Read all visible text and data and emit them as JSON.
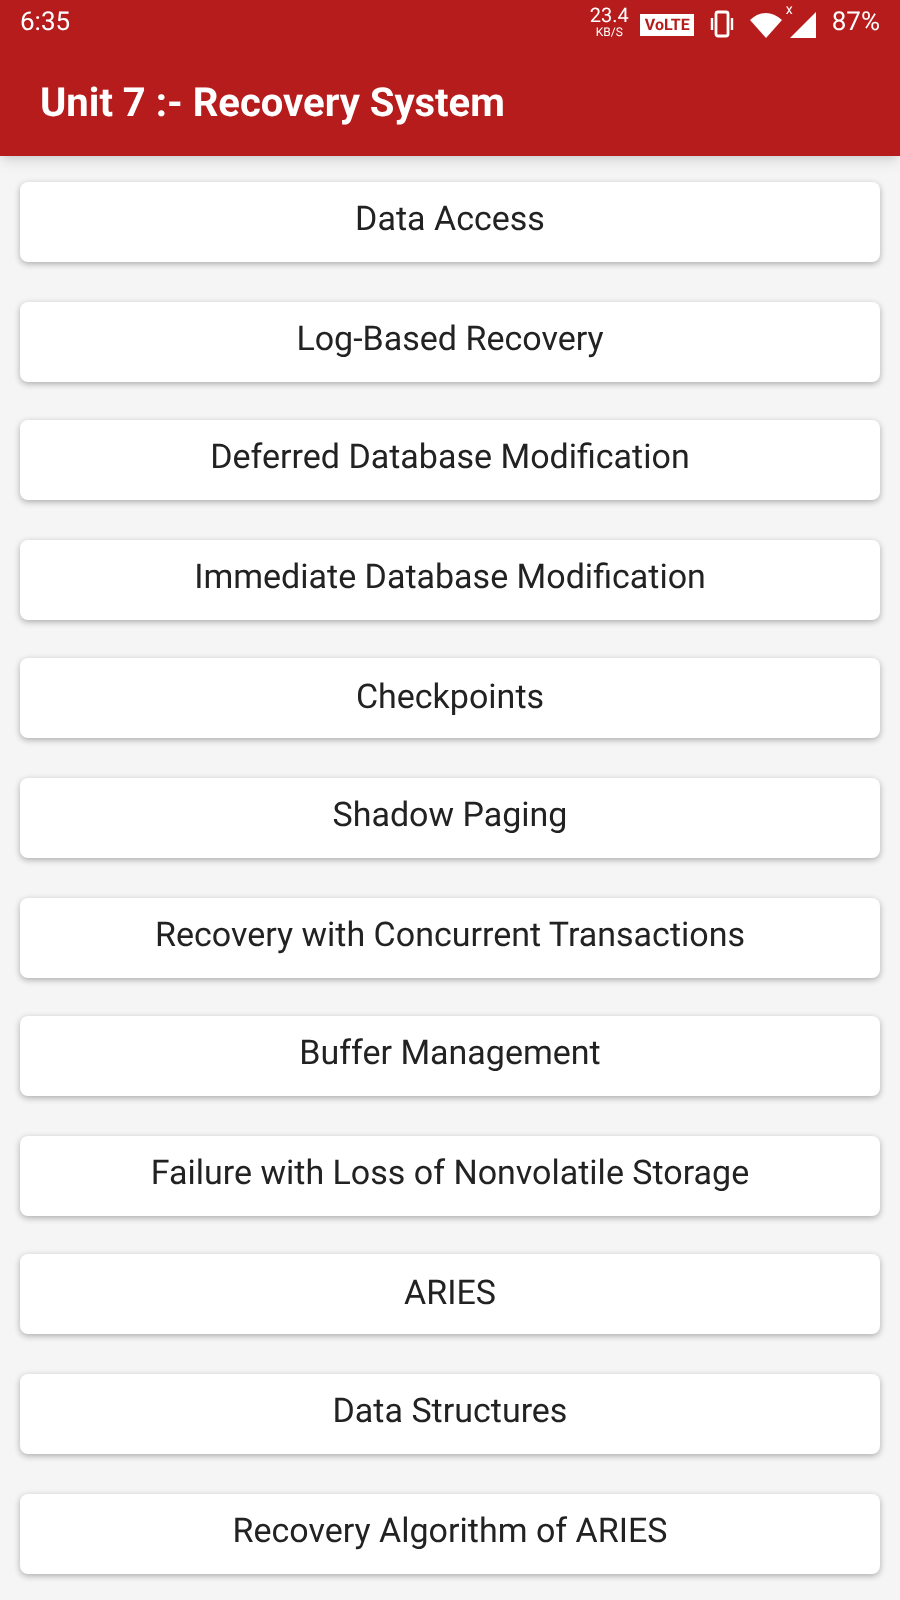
{
  "status_bar": {
    "time": "6:35",
    "speed": "23.4",
    "speed_unit": "KB/S",
    "network_badge": "VoLTE",
    "signal_mark": "x",
    "battery": "87%"
  },
  "app_bar": {
    "title": "Unit 7 :- Recovery System"
  },
  "topics": [
    {
      "label": "Data Access"
    },
    {
      "label": "Log-Based Recovery"
    },
    {
      "label": "Deferred Database Modification"
    },
    {
      "label": "Immediate Database Modification"
    },
    {
      "label": "Checkpoints"
    },
    {
      "label": "Shadow Paging"
    },
    {
      "label": "Recovery with Concurrent Transactions"
    },
    {
      "label": "Buffer Management"
    },
    {
      "label": "Failure with Loss of Nonvolatile Storage"
    },
    {
      "label": "ARIES"
    },
    {
      "label": "Data Structures"
    },
    {
      "label": "Recovery Algorithm of ARIES"
    }
  ]
}
